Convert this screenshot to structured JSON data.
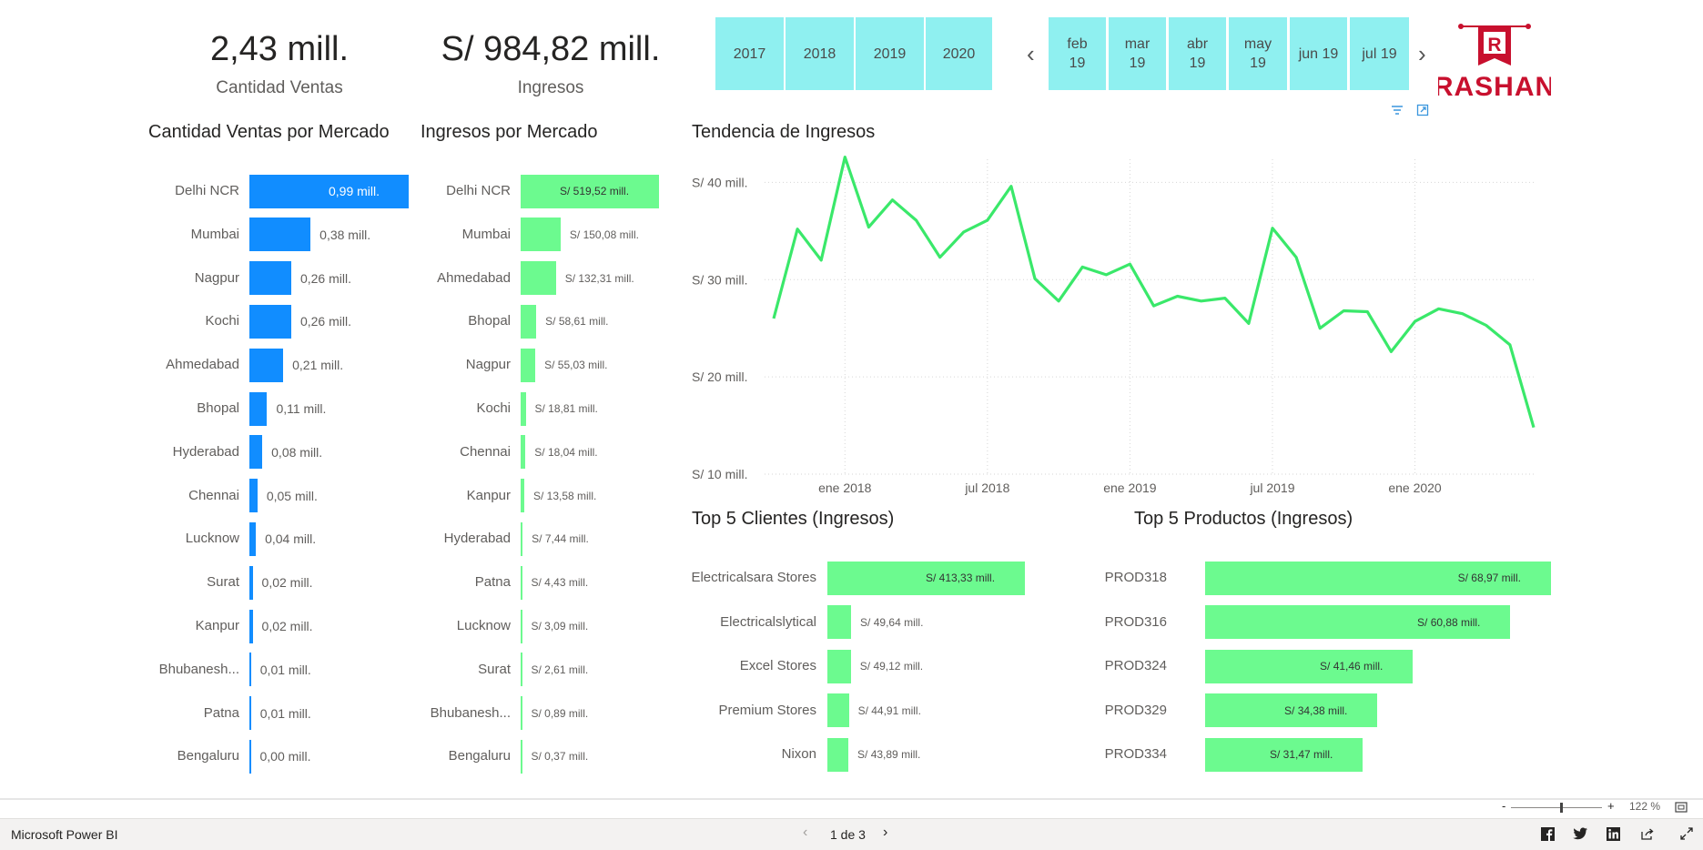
{
  "kpis": {
    "sales_qty": {
      "value": "2,43 mill.",
      "label": "Cantidad Ventas"
    },
    "revenue": {
      "value": "S/ 984,82 mill.",
      "label": "Ingresos"
    }
  },
  "year_slicer": [
    "2017",
    "2018",
    "2019",
    "2020"
  ],
  "month_slicer": [
    "feb\n19",
    "mar\n19",
    "abr\n19",
    "may\n19",
    "jun 19",
    "jul 19"
  ],
  "logo_text": "RASHAN",
  "logo_letter": "R",
  "colors": {
    "blue": "#118dff",
    "green": "#6cfa8f",
    "line": "#3ae86a",
    "slicer": "#8ff0f0"
  },
  "qty_chart": {
    "title": "Cantidad Ventas por Mercado",
    "rows": [
      {
        "cat": "Delhi NCR",
        "value": 0.99,
        "label": "0,99 mill."
      },
      {
        "cat": "Mumbai",
        "value": 0.38,
        "label": "0,38 mill."
      },
      {
        "cat": "Nagpur",
        "value": 0.26,
        "label": "0,26 mill."
      },
      {
        "cat": "Kochi",
        "value": 0.26,
        "label": "0,26 mill."
      },
      {
        "cat": "Ahmedabad",
        "value": 0.21,
        "label": "0,21 mill."
      },
      {
        "cat": "Bhopal",
        "value": 0.11,
        "label": "0,11 mill."
      },
      {
        "cat": "Hyderabad",
        "value": 0.08,
        "label": "0,08 mill."
      },
      {
        "cat": "Chennai",
        "value": 0.05,
        "label": "0,05 mill."
      },
      {
        "cat": "Lucknow",
        "value": 0.04,
        "label": "0,04 mill."
      },
      {
        "cat": "Surat",
        "value": 0.02,
        "label": "0,02 mill."
      },
      {
        "cat": "Kanpur",
        "value": 0.02,
        "label": "0,02 mill."
      },
      {
        "cat": "Bhubanesh...",
        "value": 0.01,
        "label": "0,01 mill."
      },
      {
        "cat": "Patna",
        "value": 0.01,
        "label": "0,01 mill."
      },
      {
        "cat": "Bengaluru",
        "value": 0.004,
        "label": "0,00 mill."
      }
    ]
  },
  "rev_chart": {
    "title": "Ingresos por Mercado",
    "rows": [
      {
        "cat": "Delhi NCR",
        "value": 519.52,
        "label": "S/ 519,52 mill."
      },
      {
        "cat": "Mumbai",
        "value": 150.08,
        "label": "S/ 150,08 mill."
      },
      {
        "cat": "Ahmedabad",
        "value": 132.31,
        "label": "S/ 132,31 mill."
      },
      {
        "cat": "Bhopal",
        "value": 58.61,
        "label": "S/ 58,61 mill."
      },
      {
        "cat": "Nagpur",
        "value": 55.03,
        "label": "S/ 55,03 mill."
      },
      {
        "cat": "Kochi",
        "value": 18.81,
        "label": "S/ 18,81 mill."
      },
      {
        "cat": "Chennai",
        "value": 18.04,
        "label": "S/ 18,04 mill."
      },
      {
        "cat": "Kanpur",
        "value": 13.58,
        "label": "S/ 13,58 mill."
      },
      {
        "cat": "Hyderabad",
        "value": 7.44,
        "label": "S/ 7,44 mill."
      },
      {
        "cat": "Patna",
        "value": 4.43,
        "label": "S/ 4,43 mill."
      },
      {
        "cat": "Lucknow",
        "value": 3.09,
        "label": "S/ 3,09 mill."
      },
      {
        "cat": "Surat",
        "value": 2.61,
        "label": "S/ 2,61 mill."
      },
      {
        "cat": "Bhubanesh...",
        "value": 0.89,
        "label": "S/ 0,89 mill."
      },
      {
        "cat": "Bengaluru",
        "value": 0.37,
        "label": "S/ 0,37 mill."
      }
    ]
  },
  "chart_data": {
    "type": "line",
    "title": "Tendencia de Ingresos",
    "x_ticks": [
      "ene 2018",
      "jul 2018",
      "ene 2019",
      "jul 2019",
      "ene 2020"
    ],
    "y_ticks": [
      "S/ 10 mill.",
      "S/ 20 mill.",
      "S/ 30 mill.",
      "S/ 40 mill."
    ],
    "ylim": [
      10,
      45
    ],
    "x": [
      "oct 2017",
      "nov 2017",
      "dic 2017",
      "ene 2018",
      "feb 2018",
      "mar 2018",
      "abr 2018",
      "may 2018",
      "jun 2018",
      "jul 2018",
      "ago 2018",
      "sep 2018",
      "oct 2018",
      "nov 2018",
      "dic 2018",
      "ene 2019",
      "feb 2019",
      "mar 2019",
      "abr 2019",
      "may 2019",
      "jun 2019",
      "jul 2019",
      "ago 2019",
      "sep 2019",
      "oct 2019",
      "nov 2019",
      "dic 2019",
      "ene 2020",
      "feb 2020",
      "mar 2020",
      "abr 2020",
      "may 2020",
      "jun 2020"
    ],
    "values": [
      26.0,
      35.2,
      32.0,
      42.6,
      35.4,
      38.2,
      36.1,
      32.3,
      34.9,
      36.1,
      39.6,
      30.1,
      27.8,
      31.3,
      30.5,
      31.6,
      27.3,
      28.3,
      27.8,
      28.1,
      25.5,
      35.3,
      32.3,
      25.0,
      26.8,
      26.7,
      22.6,
      25.7,
      27.0,
      26.5,
      25.3,
      23.3,
      14.8
    ],
    "grid": true,
    "color": "#3ae86a"
  },
  "top_clients": {
    "title": "Top 5 Clientes (Ingresos)",
    "rows": [
      {
        "cat": "Electricalsara Stores",
        "value": 413.33,
        "label": "S/ 413,33 mill."
      },
      {
        "cat": "Electricalslytical",
        "value": 49.64,
        "label": "S/ 49,64 mill."
      },
      {
        "cat": "Excel Stores",
        "value": 49.12,
        "label": "S/ 49,12 mill."
      },
      {
        "cat": "Premium Stores",
        "value": 44.91,
        "label": "S/ 44,91 mill."
      },
      {
        "cat": "Nixon",
        "value": 43.89,
        "label": "S/ 43,89 mill."
      }
    ]
  },
  "top_products": {
    "title": "Top 5 Productos (Ingresos)",
    "rows": [
      {
        "cat": "PROD318",
        "value": 68.97,
        "label": "S/ 68,97 mill."
      },
      {
        "cat": "PROD316",
        "value": 60.88,
        "label": "S/ 60,88 mill."
      },
      {
        "cat": "PROD324",
        "value": 41.46,
        "label": "S/ 41,46 mill."
      },
      {
        "cat": "PROD329",
        "value": 34.38,
        "label": "S/ 34,38 mill."
      },
      {
        "cat": "PROD334",
        "value": 31.47,
        "label": "S/ 31,47 mill."
      }
    ]
  },
  "footer": {
    "app_name": "Microsoft Power BI",
    "page_indicator": "1 de 3",
    "zoom": "122 %",
    "zoom_minus": "-",
    "zoom_plus": "+",
    "zoom_level": 0.55
  }
}
